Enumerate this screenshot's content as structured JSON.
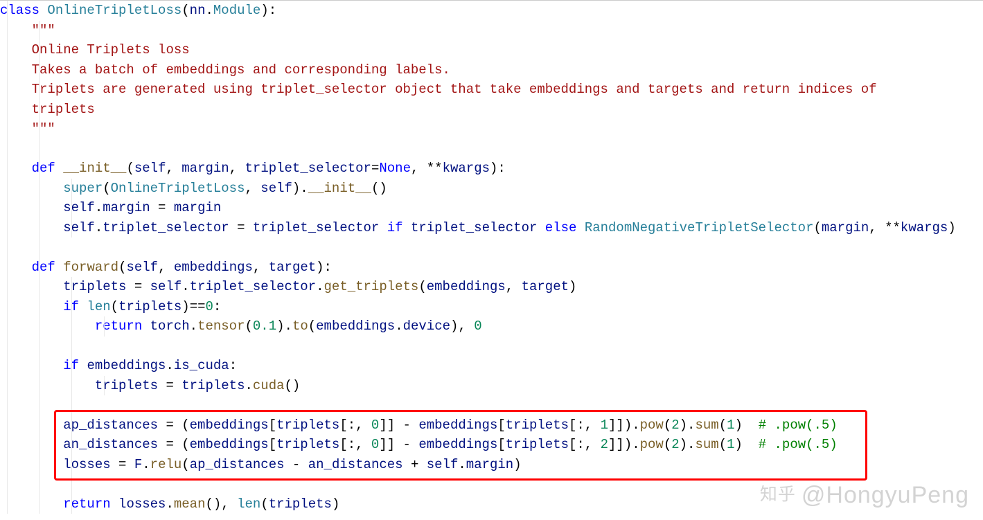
{
  "code": {
    "l1": "class OnlineTripletLoss(nn.Module):",
    "l2": "    \"\"\"",
    "l3": "    Online Triplets loss",
    "l4": "    Takes a batch of embeddings and corresponding labels.",
    "l5": "    Triplets are generated using triplet_selector object that take embeddings and targets and return indices of ",
    "l6": "    triplets",
    "l7": "    \"\"\"",
    "l8": "",
    "l9": "    def __init__(self, margin, triplet_selector=None, **kwargs):",
    "l10": "        super(OnlineTripletLoss, self).__init__()",
    "l11": "        self.margin = margin",
    "l12": "        self.triplet_selector = triplet_selector if triplet_selector else RandomNegativeTripletSelector(margin, **kwargs)",
    "l13": "",
    "l14": "    def forward(self, embeddings, target):",
    "l15": "        triplets = self.triplet_selector.get_triplets(embeddings, target)",
    "l16": "        if len(triplets)==0:",
    "l17": "            return torch.tensor(0.1).to(embeddings.device), 0",
    "l18": "",
    "l19": "        if embeddings.is_cuda:",
    "l20": "            triplets = triplets.cuda()",
    "l21": "",
    "l22": "        ap_distances = (embeddings[triplets[:, 0]] - embeddings[triplets[:, 1]]).pow(2).sum(1)  # .pow(.5)",
    "l23": "        an_distances = (embeddings[triplets[:, 0]] - embeddings[triplets[:, 2]]).pow(2).sum(1)  # .pow(.5)",
    "l24": "        losses = F.relu(ap_distances - an_distances + self.margin)",
    "l25": "",
    "l26": "        return losses.mean(), len(triplets)"
  },
  "tokens": {
    "class": "class",
    "OnlineTripletLoss": "OnlineTripletLoss",
    "nn": "nn",
    "Module": "Module",
    "tq": "\"\"\"",
    "doc1": "Online Triplets loss",
    "doc2": "Takes a batch of embeddings and corresponding labels.",
    "doc3": "Triplets are generated using triplet_selector object that take embeddings and targets and return indices of ",
    "doc4": "triplets",
    "def": "def",
    "init": "__init__",
    "self": "self",
    "margin": "margin",
    "triplet_selector": "triplet_selector",
    "None": "None",
    "kwargs": "kwargs",
    "super": "super",
    "forward": "forward",
    "embeddings": "embeddings",
    "target": "target",
    "triplets": "triplets",
    "get_triplets": "get_triplets",
    "if": "if",
    "len": "len",
    "eq0": "==",
    "zero": "0",
    "return": "return",
    "torch": "torch",
    "tensor": "tensor",
    "p0_1": "0.1",
    "to": "to",
    "device": "device",
    "is_cuda": "is_cuda",
    "cuda": "cuda",
    "ap_distances": "ap_distances",
    "an_distances": "an_distances",
    "one": "1",
    "two": "2",
    "pow": "pow",
    "sum": "sum",
    "cmt_pow5": "# .pow(.5)",
    "losses": "losses",
    "F": "F",
    "relu": "relu",
    "mean": "mean",
    "else": "else",
    "RandomNegativeTripletSelector": "RandomNegativeTripletSelector",
    "starstar": "**"
  },
  "watermark": {
    "zhihu": "知乎",
    "handle": "@HongyuPeng"
  },
  "highlight_box": {
    "top_line": 22,
    "bottom_line": 24
  }
}
